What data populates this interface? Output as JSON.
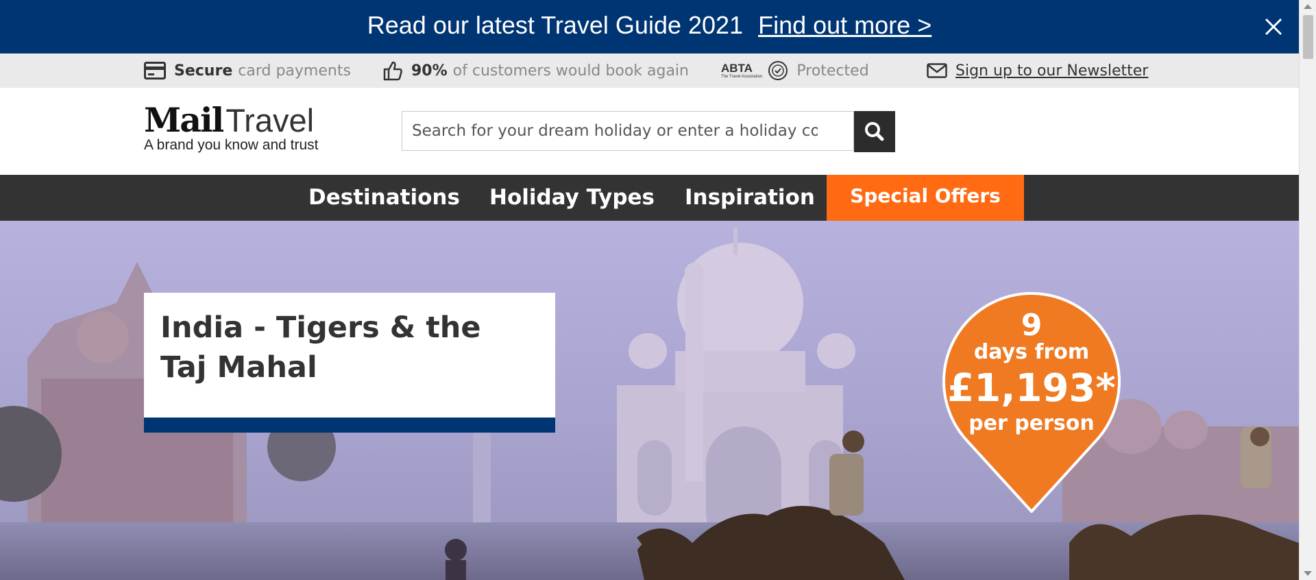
{
  "promo": {
    "text": "Read our latest Travel Guide 2021",
    "link": "Find out more >",
    "close_icon": "close-icon"
  },
  "trust_bar": {
    "secure_bold": "Secure",
    "secure_rest": "card payments",
    "book_bold": "90%",
    "book_rest": "of customers would book again",
    "abta_logo": "ABTA",
    "abta_small": "The Travel Association",
    "protected": "Protected",
    "newsletter": "Sign up to our Newsletter",
    "icons": [
      "card-icon",
      "thumbs-up-icon",
      "abta-logo",
      "shield-seal-icon",
      "envelope-icon"
    ]
  },
  "header": {
    "logo_mail": "Mail",
    "logo_travel": "Travel",
    "logo_tagline": "A brand you know and trust",
    "search_placeholder": "Search for your dream holiday or enter a holiday code",
    "search_icon": "search-icon"
  },
  "nav": {
    "items": [
      "Destinations",
      "Holiday Types",
      "Inspiration"
    ],
    "offers": "Special Offers"
  },
  "hero": {
    "title": "India - Tigers & the Taj Mahal",
    "price": {
      "days": "9",
      "days_from": "days from",
      "amount": "£1,193*",
      "per_person": "per person"
    }
  },
  "colors": {
    "brand_navy": "#003573",
    "accent_orange": "#ff6a13",
    "price_orange": "#ef7a22",
    "nav_dark": "#333333"
  }
}
